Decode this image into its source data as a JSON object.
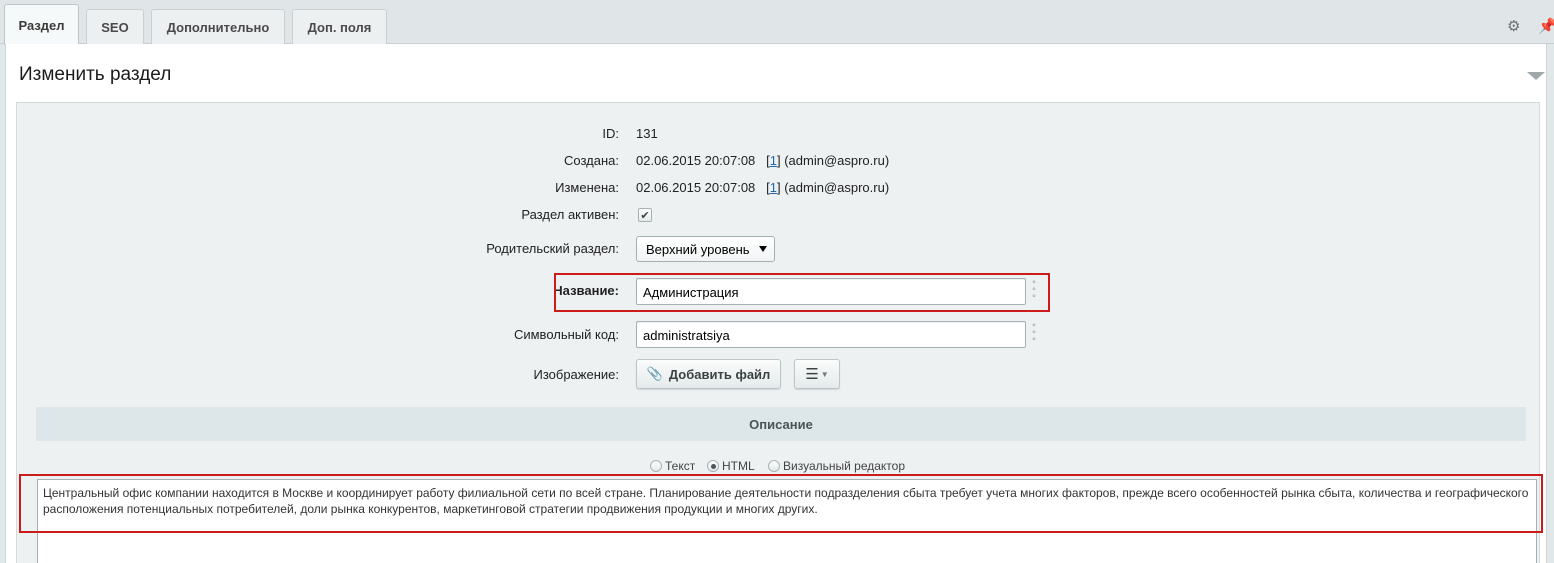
{
  "tabs": [
    {
      "label": "Раздел",
      "active": true
    },
    {
      "label": "SEO",
      "active": false
    },
    {
      "label": "Дополнительно",
      "active": false
    },
    {
      "label": "Доп. поля",
      "active": false
    }
  ],
  "header_tools": {
    "settings_icon": "gear-icon",
    "pin_icon": "pin-icon"
  },
  "panel": {
    "title": "Изменить раздел"
  },
  "fields": {
    "id": {
      "label": "ID:",
      "value": "131"
    },
    "created": {
      "label": "Создана:",
      "value": "02.06.2015 20:07:08",
      "user_link": "1",
      "user": "(admin@aspro.ru)"
    },
    "modified": {
      "label": "Изменена:",
      "value": "02.06.2015 20:07:08",
      "user_link": "1",
      "user": "(admin@aspro.ru)"
    },
    "active": {
      "label": "Раздел активен:",
      "checked": true
    },
    "parent": {
      "label": "Родительский раздел:",
      "selected": "Верхний уровень"
    },
    "name": {
      "label": "Название:",
      "value": "Администрация"
    },
    "code": {
      "label": "Символьный код:",
      "value": "administratsiya"
    },
    "image": {
      "label": "Изображение:",
      "add_button": "Добавить файл"
    }
  },
  "description": {
    "section_title": "Описание",
    "modes": [
      {
        "label": "Текст",
        "selected": false
      },
      {
        "label": "HTML",
        "selected": true
      },
      {
        "label": "Визуальный редактор",
        "selected": false
      }
    ],
    "text": "Центральный офис компании находится в Москве и координирует работу филиальной сети по всей стране. Планирование деятельности подразделения сбыта требует учета многих факторов, прежде всего особенностей рынка сбыта, количества и географического расположения потенциальных потребителей, доли рынка конкурентов, маркетинговой стратегии продвижения продукции и многих других."
  },
  "colors": {
    "highlight": "#cc1b1b",
    "link": "#2067b0"
  }
}
